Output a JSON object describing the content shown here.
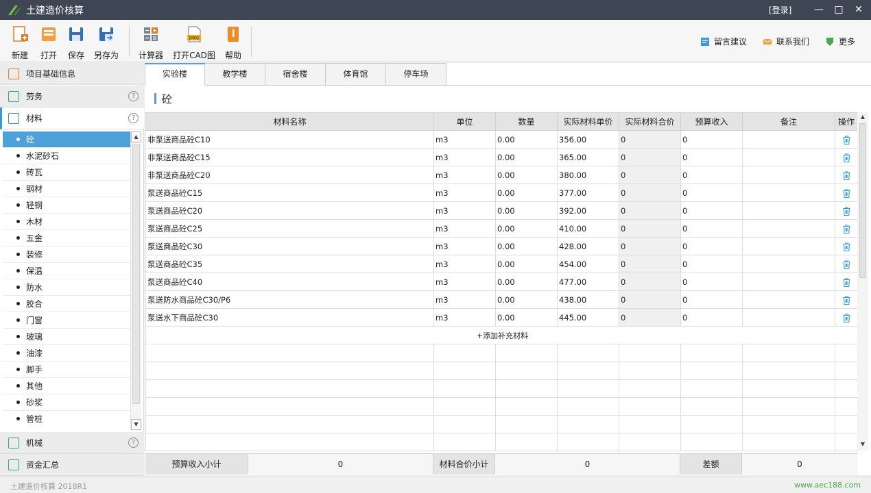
{
  "window": {
    "title": "土建造价核算",
    "login_label": "[登录]",
    "minimize_glyph": "—",
    "maximize_glyph": "□",
    "close_glyph": "✕"
  },
  "toolbar": {
    "new_label": "新建",
    "open_label": "打开",
    "save_label": "保存",
    "save_as_label": "另存为",
    "calculator_label": "计算器",
    "open_cad_label": "打开CAD图",
    "help_label": "帮助",
    "dwg_badge": "DWG",
    "feedback_label": "留言建议",
    "contact_label": "联系我们",
    "more_label": "更多"
  },
  "sidebar": {
    "sections": {
      "project_info": "项目基础信息",
      "labor": "劳务",
      "materials": "材料",
      "machinery": "机械",
      "funds_summary": "资金汇总"
    },
    "help_glyph": "?",
    "materials": [
      "砼",
      "水泥砂石",
      "砖瓦",
      "钢材",
      "轻钢",
      "木材",
      "五金",
      "装修",
      "保温",
      "防水",
      "胶合",
      "门窗",
      "玻璃",
      "油漆",
      "脚手",
      "其他",
      "砂浆",
      "管桩"
    ],
    "selected_index": 0,
    "scroll_up": "▲",
    "scroll_down": "▼"
  },
  "tabs": [
    "实验楼",
    "教学楼",
    "宿舍楼",
    "体育馆",
    "停车场"
  ],
  "active_tab": 0,
  "section_title": "砼",
  "table": {
    "columns": [
      "材料名称",
      "单位",
      "数量",
      "实际材料单价",
      "实际材料合价",
      "预算收入",
      "备注",
      "操作"
    ],
    "rows": [
      {
        "name": "非泵送商品砼C10",
        "unit": "m3",
        "qty": "0.00",
        "price": "356.00",
        "total": "0",
        "budget": "0",
        "note": ""
      },
      {
        "name": "非泵送商品砼C15",
        "unit": "m3",
        "qty": "0.00",
        "price": "365.00",
        "total": "0",
        "budget": "0",
        "note": ""
      },
      {
        "name": "非泵送商品砼C20",
        "unit": "m3",
        "qty": "0.00",
        "price": "380.00",
        "total": "0",
        "budget": "0",
        "note": ""
      },
      {
        "name": "泵送商品砼C15",
        "unit": "m3",
        "qty": "0.00",
        "price": "377.00",
        "total": "0",
        "budget": "0",
        "note": ""
      },
      {
        "name": "泵送商品砼C20",
        "unit": "m3",
        "qty": "0.00",
        "price": "392.00",
        "total": "0",
        "budget": "0",
        "note": ""
      },
      {
        "name": "泵送商品砼C25",
        "unit": "m3",
        "qty": "0.00",
        "price": "410.00",
        "total": "0",
        "budget": "0",
        "note": ""
      },
      {
        "name": "泵送商品砼C30",
        "unit": "m3",
        "qty": "0.00",
        "price": "428.00",
        "total": "0",
        "budget": "0",
        "note": ""
      },
      {
        "name": "泵送商品砼C35",
        "unit": "m3",
        "qty": "0.00",
        "price": "454.00",
        "total": "0",
        "budget": "0",
        "note": ""
      },
      {
        "name": "泵送商品砼C40",
        "unit": "m3",
        "qty": "0.00",
        "price": "477.00",
        "total": "0",
        "budget": "0",
        "note": ""
      },
      {
        "name": "泵送防水商品砼C30/P6",
        "unit": "m3",
        "qty": "0.00",
        "price": "438.00",
        "total": "0",
        "budget": "0",
        "note": ""
      },
      {
        "name": "泵送水下商品砼C30",
        "unit": "m3",
        "qty": "0.00",
        "price": "445.00",
        "total": "0",
        "budget": "0",
        "note": ""
      }
    ],
    "add_row_label": "+添加补充材料",
    "empty_rows": 6,
    "delete_icon": "trash-icon"
  },
  "totals": {
    "budget_subtotal_label": "预算收入小计",
    "budget_subtotal_value": "0",
    "material_subtotal_label": "材料合价小计",
    "material_subtotal_value": "0",
    "difference_label": "差额",
    "difference_value": "0"
  },
  "statusbar": {
    "version": "土建造价核算 2018R1",
    "website": "www.aec188.com"
  },
  "colors": {
    "titlebar": "#3e4653",
    "accent": "#4da0d8",
    "icon_orange": "#e07c2c",
    "icon_blue": "#2f6fbf",
    "website_green": "#4aa84a"
  }
}
